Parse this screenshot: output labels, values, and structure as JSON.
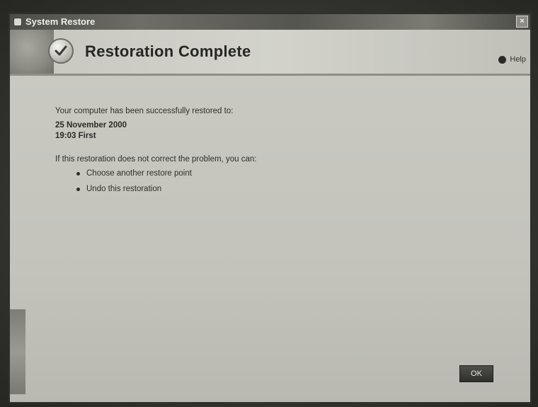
{
  "window": {
    "title": "System Restore",
    "close_glyph": "×"
  },
  "header": {
    "title": "Restoration Complete",
    "help_label": "Help",
    "icon": "checkmark-icon"
  },
  "main": {
    "success_message": "Your computer has been successfully restored to:",
    "restore_date": "25 November 2000",
    "restore_time": "19:03 First",
    "problem_prompt": "If this restoration does not correct the problem, you can:",
    "options": [
      {
        "label": "Choose another restore point"
      },
      {
        "label": "Undo this restoration"
      }
    ]
  },
  "footer": {
    "ok_label": "OK"
  }
}
